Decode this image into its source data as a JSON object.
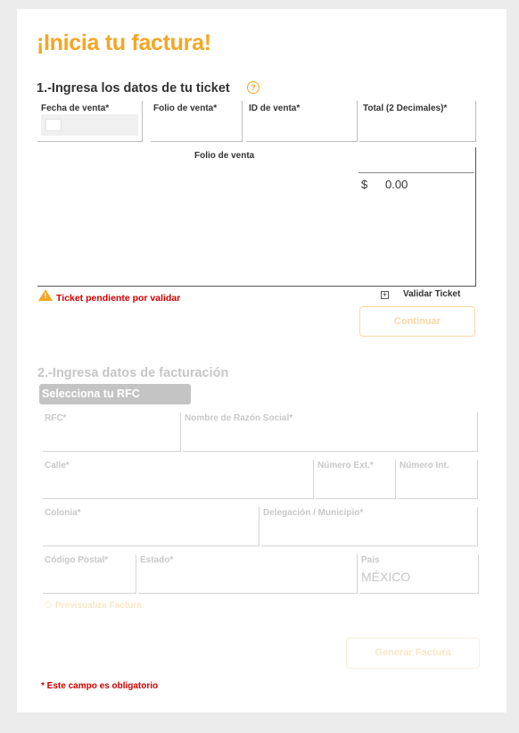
{
  "title": "¡Inicia tu factura!",
  "section1": {
    "title": "1.-Ingresa los datos de tu ticket",
    "help_icon": "question-circle-icon",
    "fields": {
      "fecha": "Fecha de venta*",
      "folio": "Folio de venta*",
      "id": "ID de venta*",
      "total": "Total (2 Decimales)*"
    },
    "table": {
      "folio_header": "Folio de venta",
      "currency": "$",
      "total": "0.00"
    },
    "warning": {
      "icon": "warning-triangle-icon",
      "text": "Ticket pendiente por validar"
    },
    "validate_label": "Validar Ticket",
    "continue_button": "Continuar"
  },
  "section2": {
    "title": "2.-Ingresa datos de facturación",
    "rfc_select": "Selecciona tu RFC",
    "fields": {
      "rfc": "RFC*",
      "razon": "Nombre de Razón Social*",
      "calle": "Calle*",
      "num_ext": "Número Ext.*",
      "num_int": "Número Int.",
      "colonia": "Colonia*",
      "delegacion": "Delegación / Municipio*",
      "cp": "Código Postal*",
      "estado": "Estado*",
      "pais": "País",
      "pais_value": "MÉXICO"
    },
    "preview_label": "Previsualiza Factura",
    "generate_button": "Generar Factura"
  },
  "required_note": "* Este campo es obligatorio",
  "colors": {
    "accent": "#f5a623",
    "error": "#cc0000",
    "disabled": "#c6c6c6"
  }
}
